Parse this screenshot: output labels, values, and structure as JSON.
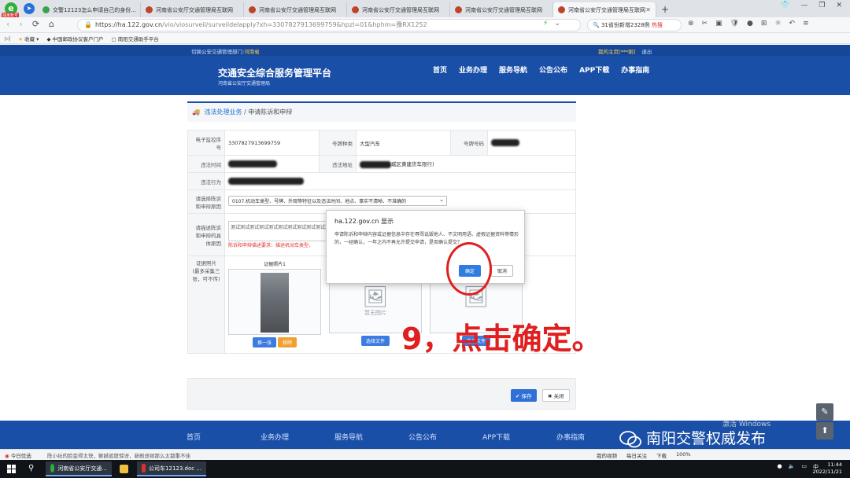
{
  "browser": {
    "tag": "独家账号",
    "tabs": [
      {
        "label": "交警12123怎么申请自己的身份...",
        "favicon": "green"
      },
      {
        "label": "河南省公安厅交通管理局互联网",
        "favicon": "red"
      },
      {
        "label": "河南省公安厅交通管理局互联网",
        "favicon": "red"
      },
      {
        "label": "河南省公安厅交通管理局互联网",
        "favicon": "red"
      },
      {
        "label": "河南省公安厅交通管理局互联网",
        "favicon": "red"
      },
      {
        "label": "河南省公安厅交通管理局互联网",
        "favicon": "red",
        "active": true
      }
    ],
    "url_host": "https://ha.122.gov.cn",
    "url_path": "/vio/viosurveil/surveildelapply?xh=3307827913699759&hpzl=01&hphm=豫RX1252",
    "search_text": "31省份新增2328例",
    "search_hot": "热搜",
    "bookmarks": [
      "收藏",
      "中国邮政协议客户门户",
      "南阳交通助手平台"
    ]
  },
  "site": {
    "switch_label": "切换公安交通管理部门:",
    "province": "河南省",
    "user_links": [
      "我的主页[***刚]",
      "退出"
    ],
    "title": "交通安全综合服务管理平台",
    "subtitle": "河南省公安厅交通管理局",
    "nav": [
      "首页",
      "业务办理",
      "服务导航",
      "公告公布",
      "APP下载",
      "办事指南"
    ]
  },
  "breadcrumb": {
    "root": "违法处理业务",
    "current": "申请陈诉和申辩"
  },
  "form": {
    "labels": {
      "monitor_no": "电子监控序号",
      "plate_type": "号牌种类",
      "plate_no": "号牌号码",
      "time": "违法时间",
      "place": "违法地址",
      "act": "违法行为",
      "reason_select": "请选择陈诉和申辩原因",
      "reason_detail": "请描述陈诉和申辩的具体原因",
      "photos": "证据照片\n(最多采集三张，可不传)"
    },
    "values": {
      "monitor_no": "3307827913699759",
      "plate_type": "大型汽车",
      "place_tail": "城区黄建货车限行)",
      "reason_select": "0107.机动车类型、号牌、外观等特征以及违法时间、地点、事实不清晰、不准确的",
      "reason_detail": "测试测试测试测试测试测试测试测试测试测试测试",
      "requirement": "陈诉和申辩描述要求：描述机动车类型、"
    },
    "photo_title": "证据照片1",
    "no_image": "暂无图片",
    "buttons": {
      "replace": "换一张",
      "remove": "移除",
      "choose1": "选择文件",
      "choose2": "选择文件"
    }
  },
  "actions": {
    "save": "保存",
    "close": "关闭"
  },
  "dialog": {
    "title": "ha.122.gov.cn 显示",
    "message": "申请陈诉和申辩内容或证据信息中存在辱骂诋毁他人、不文明用语、虚假证据资料等情形的，一经确认，一年之内不再允许提交申请，是否确认提交？",
    "ok": "确定",
    "cancel": "取消"
  },
  "annotation": "9，点击确定。",
  "footer": {
    "nav": [
      "首页",
      "业务办理",
      "服务导航",
      "公告公布",
      "APP下载",
      "办事指南"
    ],
    "windows_watermark": "激活 Windows",
    "wechat_brand": "南阳交警权威发布"
  },
  "statusbar": {
    "left": "今日优选",
    "news": "陈小纭的脸歪得太快，颤撼遮度惊讶，新剧逐顿那么太都重不佳",
    "right": [
      "我的视频",
      "每日关注",
      "下载",
      "100%"
    ]
  },
  "taskbar": {
    "apps": [
      "河南省公安厅交通...",
      "",
      "公司车12123.doc ..."
    ],
    "time": "11:44",
    "date": "2022/11/21"
  }
}
